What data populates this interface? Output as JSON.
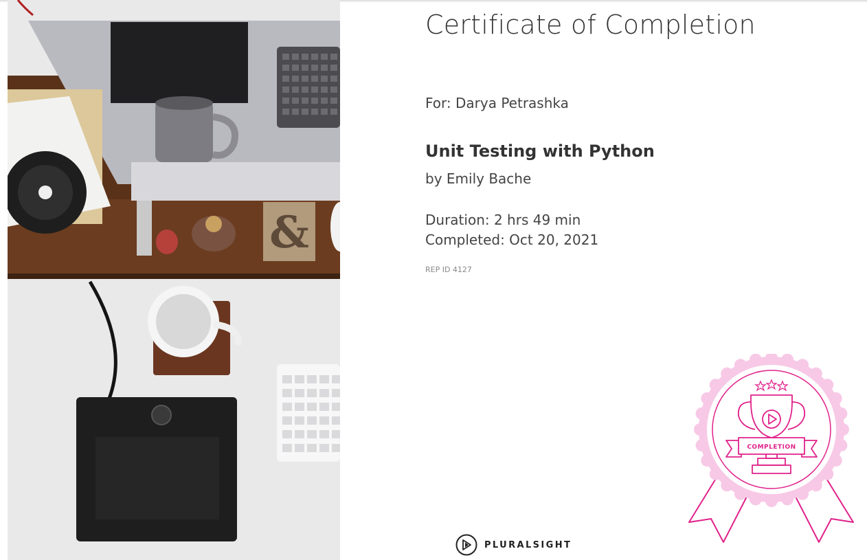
{
  "certificate": {
    "title": "Certificate of Completion",
    "recipient_line": "For: Darya Petrashka",
    "course_title": "Unit Testing with Python",
    "author_line": "by Emily Bache",
    "duration_line": "Duration: 2 hrs 49 min",
    "completed_line": "Completed: Oct 20, 2021",
    "rep_id": "REP ID 4127"
  },
  "badge": {
    "label": "COMPLETION",
    "icon": "trophy-ribbon-badge-icon",
    "color": "#e0218a",
    "glow_color": "#f7c9e6"
  },
  "brand": {
    "name": "PLURALSIGHT",
    "icon": "pluralsight-play-logo-icon"
  },
  "photo": {
    "icon": "desk-workspace-photo"
  }
}
